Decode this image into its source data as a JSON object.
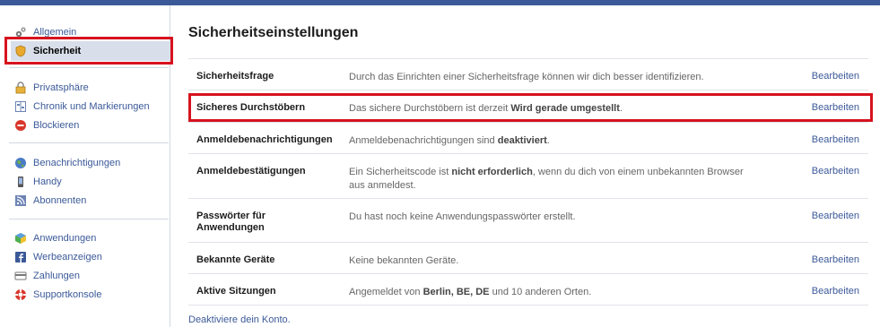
{
  "sidebar": {
    "items": [
      {
        "label": "Allgemein",
        "icon": "gears-icon"
      },
      {
        "label": "Sicherheit",
        "icon": "shield-icon"
      },
      {
        "label": "Privatsphäre",
        "icon": "lock-icon"
      },
      {
        "label": "Chronik und Markierungen",
        "icon": "timeline-icon"
      },
      {
        "label": "Blockieren",
        "icon": "block-icon"
      },
      {
        "label": "Benachrichtigungen",
        "icon": "globe-icon"
      },
      {
        "label": "Handy",
        "icon": "phone-icon"
      },
      {
        "label": "Abonnenten",
        "icon": "rss-icon"
      },
      {
        "label": "Anwendungen",
        "icon": "apps-icon"
      },
      {
        "label": "Werbeanzeigen",
        "icon": "facebook-icon"
      },
      {
        "label": "Zahlungen",
        "icon": "card-icon"
      },
      {
        "label": "Supportkonsole",
        "icon": "lifebuoy-icon"
      }
    ]
  },
  "main": {
    "title": "Sicherheitseinstellungen",
    "edit_label": "Bearbeiten",
    "rows": [
      {
        "label": "Sicherheitsfrage",
        "desc_pre": "Durch das Einrichten einer Sicherheitsfrage können wir dich besser identifizieren.",
        "desc_bold": "",
        "desc_post": ""
      },
      {
        "label": "Sicheres Durchstöbern",
        "desc_pre": "Das sichere Durchstöbern ist derzeit ",
        "desc_bold": "Wird gerade umgestellt",
        "desc_post": "."
      },
      {
        "label": "Anmeldebenachrichtigungen",
        "desc_pre": "Anmeldebenachrichtigungen sind ",
        "desc_bold": "deaktiviert",
        "desc_post": "."
      },
      {
        "label": "Anmeldebestätigungen",
        "desc_pre": "Ein Sicherheitscode ist ",
        "desc_bold": "nicht erforderlich",
        "desc_post": ", wenn du dich von einem unbekannten Browser aus anmeldest."
      },
      {
        "label": "Passwörter für Anwendungen",
        "desc_pre": "Du hast noch keine Anwendungspasswörter erstellt.",
        "desc_bold": "",
        "desc_post": ""
      },
      {
        "label": "Bekannte Geräte",
        "desc_pre": "Keine bekannten Geräte.",
        "desc_bold": "",
        "desc_post": ""
      },
      {
        "label": "Aktive Sitzungen",
        "desc_pre": "Angemeldet von ",
        "desc_bold": "Berlin, BE, DE",
        "desc_post": " und 10 anderen Orten."
      }
    ],
    "deactivate": "Deaktiviere dein Konto."
  },
  "colors": {
    "link": "#3b5998",
    "highlight": "#d6131e",
    "selected_bg": "#d8dfea"
  }
}
